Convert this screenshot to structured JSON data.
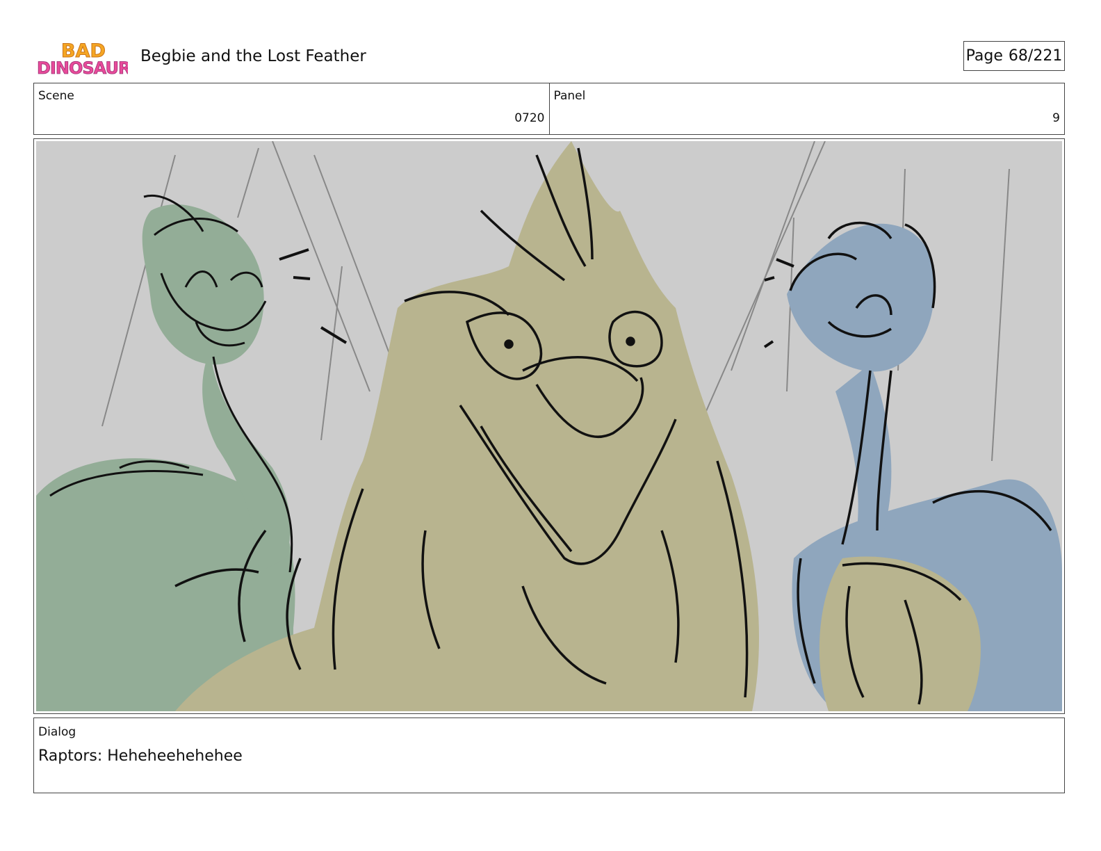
{
  "header": {
    "logo_text": "BAD DINOSAURS",
    "title": "Begbie and the Lost Feather",
    "page_label": "Page",
    "page_number": "68/221"
  },
  "info": {
    "scene_label": "Scene",
    "scene_value": "0720",
    "panel_label": "Panel",
    "panel_value": "9"
  },
  "panel_image": {
    "description_icon": "storyboard-sketch-icon",
    "background_color": "#cccccc",
    "colors": {
      "green_raptor": "#93ad97",
      "center_dino": "#b8b48f",
      "blue_raptor": "#8fa6bd",
      "ink": "#111111"
    }
  },
  "dialog": {
    "label": "Dialog",
    "text": "Raptors: Heheheehehehee"
  }
}
